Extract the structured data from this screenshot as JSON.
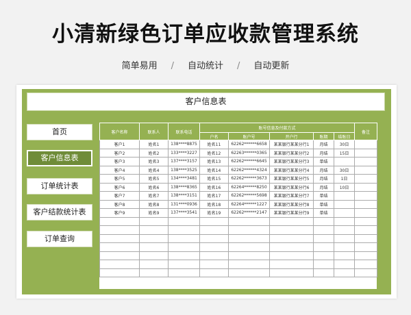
{
  "hero": {
    "title": "小清新绿色订单应收款管理系统",
    "features": [
      "简单易用",
      "自动统计",
      "自动更新"
    ],
    "separator": "/"
  },
  "app": {
    "header_title": "客户信息表",
    "nav": [
      {
        "label": "首页",
        "active": false
      },
      {
        "label": "客户信息表",
        "active": true
      },
      {
        "label": "订单统计表",
        "active": false
      },
      {
        "label": "客户结款统计表",
        "active": false
      },
      {
        "label": "订单查询",
        "active": false
      }
    ]
  },
  "table": {
    "headers": {
      "customer_name": "客户名称",
      "contact": "联系人",
      "phone": "联系电话",
      "account_group": "账号信息及付款方式",
      "account_name": "户名",
      "account_no": "账户号",
      "bank": "开户行",
      "terms": "账期",
      "settle_day": "结账日",
      "remark": "备注"
    },
    "rows": [
      [
        "客户1",
        "姓名1",
        "138****8875",
        "姓名11",
        "62262******6658",
        "某某银行某某分行1",
        "月结",
        "30日",
        ""
      ],
      [
        "客户2",
        "姓名2",
        "133****3227",
        "姓名12",
        "62263******0365",
        "某某银行某某分行2",
        "月结",
        "15日",
        ""
      ],
      [
        "客户3",
        "姓名3",
        "137****3157",
        "姓名13",
        "62262******6645",
        "某某银行某某分行3",
        "单结",
        "",
        ""
      ],
      [
        "客户4",
        "姓名4",
        "138****3525",
        "姓名14",
        "62262******4324",
        "某某银行某某分行4",
        "月结",
        "30日",
        ""
      ],
      [
        "客户5",
        "姓名5",
        "134****3481",
        "姓名15",
        "62262******3673",
        "某某银行某某分行5",
        "月结",
        "1日",
        ""
      ],
      [
        "客户6",
        "姓名6",
        "138****8365",
        "姓名16",
        "62264******8250",
        "某某银行某某分行6",
        "月结",
        "10日",
        ""
      ],
      [
        "客户7",
        "姓名7",
        "138****3151",
        "姓名17",
        "62262******5698",
        "某某银行某某分行7",
        "单结",
        "",
        ""
      ],
      [
        "客户8",
        "姓名8",
        "131****0936",
        "姓名18",
        "62264******1227",
        "某某银行某某分行8",
        "单结",
        "",
        ""
      ],
      [
        "客户9",
        "姓名9",
        "137****3541",
        "姓名19",
        "62262******2147",
        "某某银行某某分行9",
        "单结",
        "",
        ""
      ]
    ],
    "empty_rows": 7
  },
  "colors": {
    "accent_green": "#95b152",
    "active_green": "#6f8c38",
    "background": "#f2f2f2"
  }
}
